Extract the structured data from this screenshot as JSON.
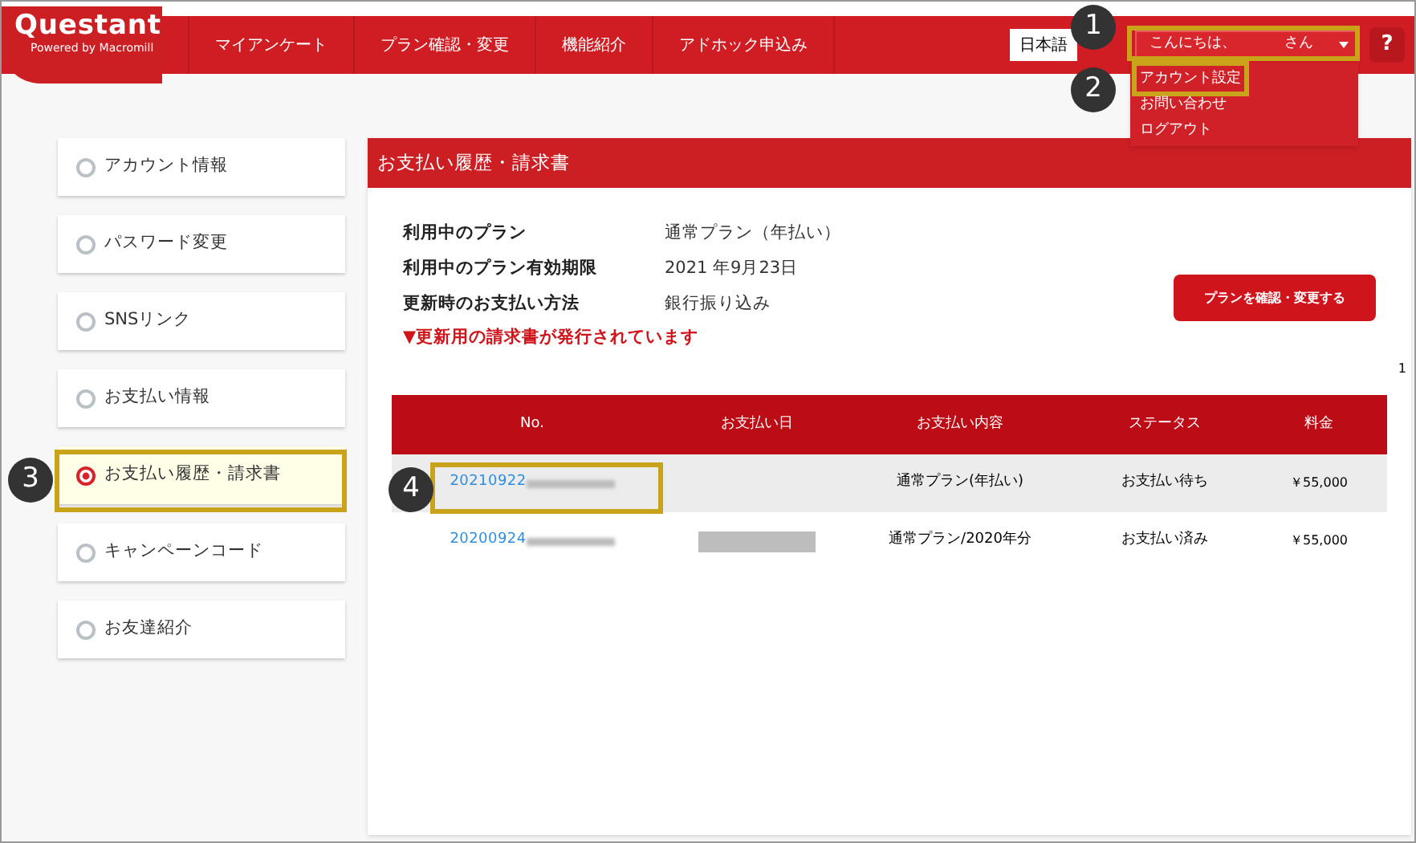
{
  "header": {
    "logo": {
      "title": "Questant",
      "subtitle": "Powered by Macromill"
    },
    "nav": [
      "マイアンケート",
      "プラン確認・変更",
      "機能紹介",
      "アドホック申込み"
    ],
    "language": "日本語",
    "greeting": {
      "text": "こんにちは、",
      "suffix": "さん"
    },
    "help": "?"
  },
  "user_menu": [
    {
      "label": "アカウント設定",
      "highlighted": true
    },
    {
      "label": "お問い合わせ",
      "highlighted": false
    },
    {
      "label": "ログアウト",
      "highlighted": false
    }
  ],
  "sidebar": {
    "items": [
      {
        "label": "アカウント情報",
        "selected": false
      },
      {
        "label": "パスワード変更",
        "selected": false
      },
      {
        "label": "SNSリンク",
        "selected": false
      },
      {
        "label": "お支払い情報",
        "selected": false
      },
      {
        "label": "お支払い履歴・請求書",
        "selected": true
      },
      {
        "label": "キャンペーンコード",
        "selected": false
      },
      {
        "label": "お友達紹介",
        "selected": false
      }
    ]
  },
  "panel": {
    "title": "お支払い履歴・請求書",
    "info": [
      {
        "label": "利用中のプラン",
        "value": "通常プラン（年払い）"
      },
      {
        "label": "利用中のプラン有効期限",
        "value": "2021 年9月23日"
      },
      {
        "label": "更新時のお支払い方法",
        "value": "銀行振り込み"
      }
    ],
    "notice": "▼更新用の請求書が発行されています",
    "button": "プランを確認・変更する",
    "page": "1",
    "table": {
      "columns": [
        "No.",
        "お支払い日",
        "お支払い内容",
        "ステータス",
        "料金"
      ],
      "rows": [
        {
          "no": "20210922",
          "date_redacted": false,
          "content": "通常プラン(年払い)",
          "status": "お支払い待ち",
          "amount": "￥55,000",
          "selected": true
        },
        {
          "no": "20200924",
          "date_redacted": true,
          "content": "通常プラン/2020年分",
          "status": "お支払い済み",
          "amount": "￥55,000",
          "selected": false
        }
      ]
    }
  },
  "callouts": [
    "1",
    "2",
    "3",
    "4"
  ]
}
